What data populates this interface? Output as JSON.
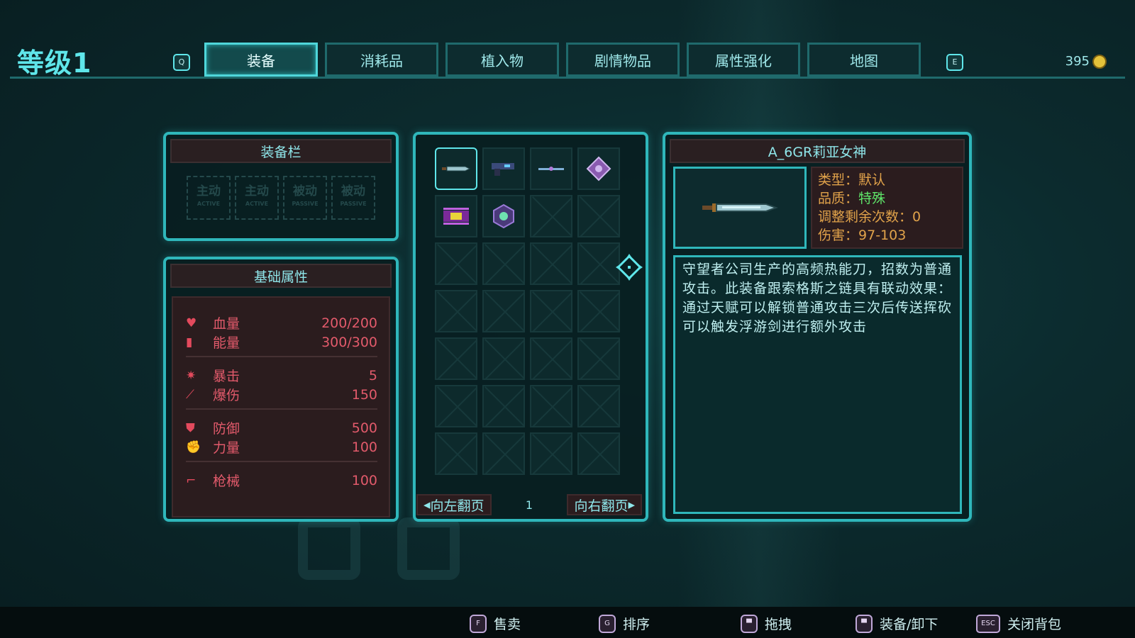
{
  "header": {
    "level_label": "等级1",
    "left_key": "Q",
    "right_key": "E",
    "currency_amount": "395",
    "tabs": [
      {
        "label": "装备",
        "active": true
      },
      {
        "label": "消耗品",
        "active": false
      },
      {
        "label": "植入物",
        "active": false
      },
      {
        "label": "剧情物品",
        "active": false
      },
      {
        "label": "属性强化",
        "active": false
      },
      {
        "label": "地图",
        "active": false
      }
    ]
  },
  "equip_slots": {
    "title": "装备栏",
    "slots": [
      {
        "label": "主动",
        "sub": "ACTIVE"
      },
      {
        "label": "主动",
        "sub": "ACTIVE"
      },
      {
        "label": "被动",
        "sub": "PASSIVE"
      },
      {
        "label": "被动",
        "sub": "PASSIVE"
      }
    ]
  },
  "stats": {
    "title": "基础属性",
    "groups": [
      [
        {
          "icon": "heart-icon",
          "glyph": "♥",
          "name": "血量",
          "value": "200/200"
        },
        {
          "icon": "battery-icon",
          "glyph": "▮",
          "name": "能量",
          "value": "300/300"
        }
      ],
      [
        {
          "icon": "crit-icon",
          "glyph": "✷",
          "name": "暴击",
          "value": "5"
        },
        {
          "icon": "crit-damage-icon",
          "glyph": "⟋",
          "name": "爆伤",
          "value": "150"
        }
      ],
      [
        {
          "icon": "shield-icon",
          "glyph": "⛊",
          "name": "防御",
          "value": "500"
        },
        {
          "icon": "fist-icon",
          "glyph": "✊",
          "name": "力量",
          "value": "100"
        }
      ],
      [
        {
          "icon": "gun-icon",
          "glyph": "⌐",
          "name": "枪械",
          "value": "100"
        }
      ]
    ]
  },
  "inventory": {
    "items": [
      "blade-icon",
      "pistol-icon",
      "rod-icon",
      "diamond-gem-icon",
      "chip-icon",
      "orb-icon"
    ],
    "prev_label": "向左翻页",
    "next_label": "向右翻页",
    "page": "1"
  },
  "detail": {
    "name": "A_6GR莉亚女神",
    "type_key": "类型：",
    "type_val": "默认",
    "quality_key": "品质：",
    "quality_val": "特殊",
    "adjust_key": "调整剩余次数：",
    "adjust_val": "0",
    "damage_key": "伤害：",
    "damage_val": "97-103",
    "description": "守望者公司生产的高频热能刀，招数为普通攻击。此装备跟索格斯之链具有联动效果：通过天赋可以解锁普通攻击三次后传送挥砍可以触发浮游剑进行额外攻击",
    "rarity_color": "#5fe66a"
  },
  "footer": {
    "hints": [
      {
        "key": "F",
        "label": "售卖"
      },
      {
        "key": "G",
        "label": "排序"
      },
      {
        "key": "",
        "label": "拖拽"
      },
      {
        "key": "",
        "label": "装备/卸下"
      },
      {
        "key": "ESC",
        "label": "关闭背包"
      }
    ]
  },
  "colors": {
    "accent": "#2fb7bb",
    "stat_text": "#e25a6b",
    "warm_text": "#e0a24a"
  }
}
